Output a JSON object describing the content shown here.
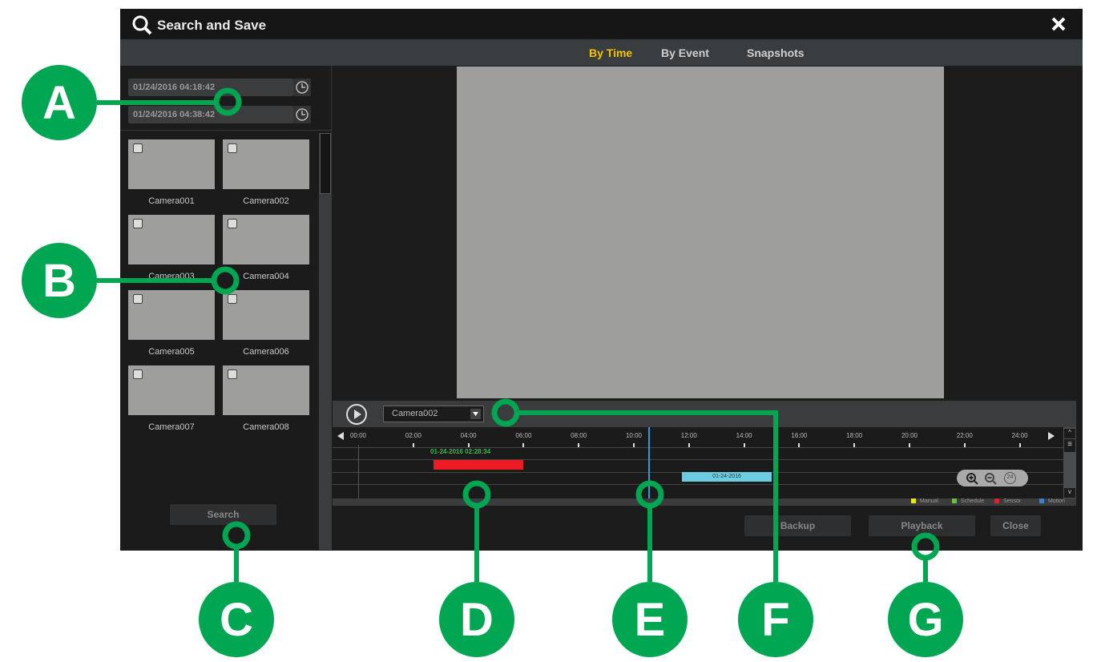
{
  "dialog": {
    "title": "Search and Save",
    "close_icon": "close-icon"
  },
  "tabs": [
    {
      "label": "By Time",
      "active": true
    },
    {
      "label": "By Event",
      "active": false
    },
    {
      "label": "Snapshots",
      "active": false
    }
  ],
  "search": {
    "start_time": "01/24/2016 04:18:42",
    "end_time": "01/24/2016 04:38:42",
    "button": "Search"
  },
  "cameras": [
    "Camera001",
    "Camera002",
    "Camera003",
    "Camera004",
    "Camera005",
    "Camera006",
    "Camera007",
    "Camera008"
  ],
  "player": {
    "camera_select": "Camera002"
  },
  "timeline": {
    "ticks": [
      "00:00",
      "02:00",
      "04:00",
      "06:00",
      "08:00",
      "10:00",
      "12:00",
      "14:00",
      "16:00",
      "18:00",
      "20:00",
      "22:00",
      "24:00"
    ],
    "cursor_label": "01-24-2016  02:28:34",
    "cursor_hour": 10.55,
    "segments": [
      {
        "type": "Sensor",
        "start_hour": 2.73,
        "end_hour": 6.0,
        "color": "#ed1c24",
        "label": ""
      },
      {
        "type": "Motion",
        "start_hour": 11.75,
        "end_hour": 15.0,
        "color": "#6dcde0",
        "label": "01-24-2016"
      }
    ],
    "legend": [
      {
        "label": "Manual",
        "color": "#f2e600"
      },
      {
        "label": "Schedule",
        "color": "#6cbf3c"
      },
      {
        "label": "Sensor",
        "color": "#ed1c24"
      },
      {
        "label": "Motion",
        "color": "#3a7fd0"
      }
    ],
    "zoom_reset": "24"
  },
  "buttons": {
    "backup": "Backup",
    "playback": "Playback",
    "close": "Close"
  },
  "callouts": [
    "A",
    "B",
    "C",
    "D",
    "E",
    "F",
    "G"
  ],
  "colors": {
    "callout": "#00a651",
    "active_tab": "#f2c200"
  }
}
